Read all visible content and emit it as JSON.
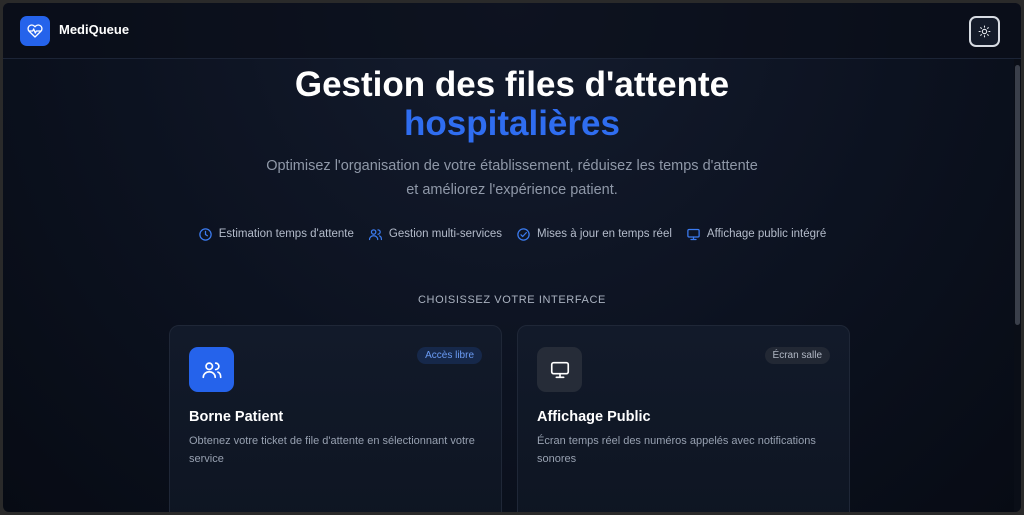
{
  "header": {
    "brand": "MediQueue",
    "logo_icon": "heart-pulse-icon",
    "theme_icon": "sun-icon"
  },
  "hero": {
    "title_line1": "Gestion des files d'attente",
    "title_line2": "hospitalières",
    "subtitle": "Optimisez l'organisation de votre établissement, réduisez les temps d'attente et améliorez l'expérience patient."
  },
  "features": [
    {
      "icon": "clock-icon",
      "label": "Estimation temps d'attente"
    },
    {
      "icon": "users-icon",
      "label": "Gestion multi-services"
    },
    {
      "icon": "check-circle-icon",
      "label": "Mises à jour en temps réel"
    },
    {
      "icon": "monitor-icon",
      "label": "Affichage public intégré"
    }
  ],
  "section_label": "CHOISISSEZ VOTRE INTERFACE",
  "cards": [
    {
      "icon": "users-icon",
      "badge": "Accès libre",
      "title": "Borne Patient",
      "description": "Obtenez votre ticket de file d'attente en sélectionnant votre service"
    },
    {
      "icon": "monitor-icon",
      "badge": "Écran salle",
      "title": "Affichage Public",
      "description": "Écran temps réel des numéros appelés avec notifications sonores"
    }
  ],
  "colors": {
    "accent": "#2563eb",
    "accent_text": "#2f6df0",
    "background": "#0c1220"
  }
}
